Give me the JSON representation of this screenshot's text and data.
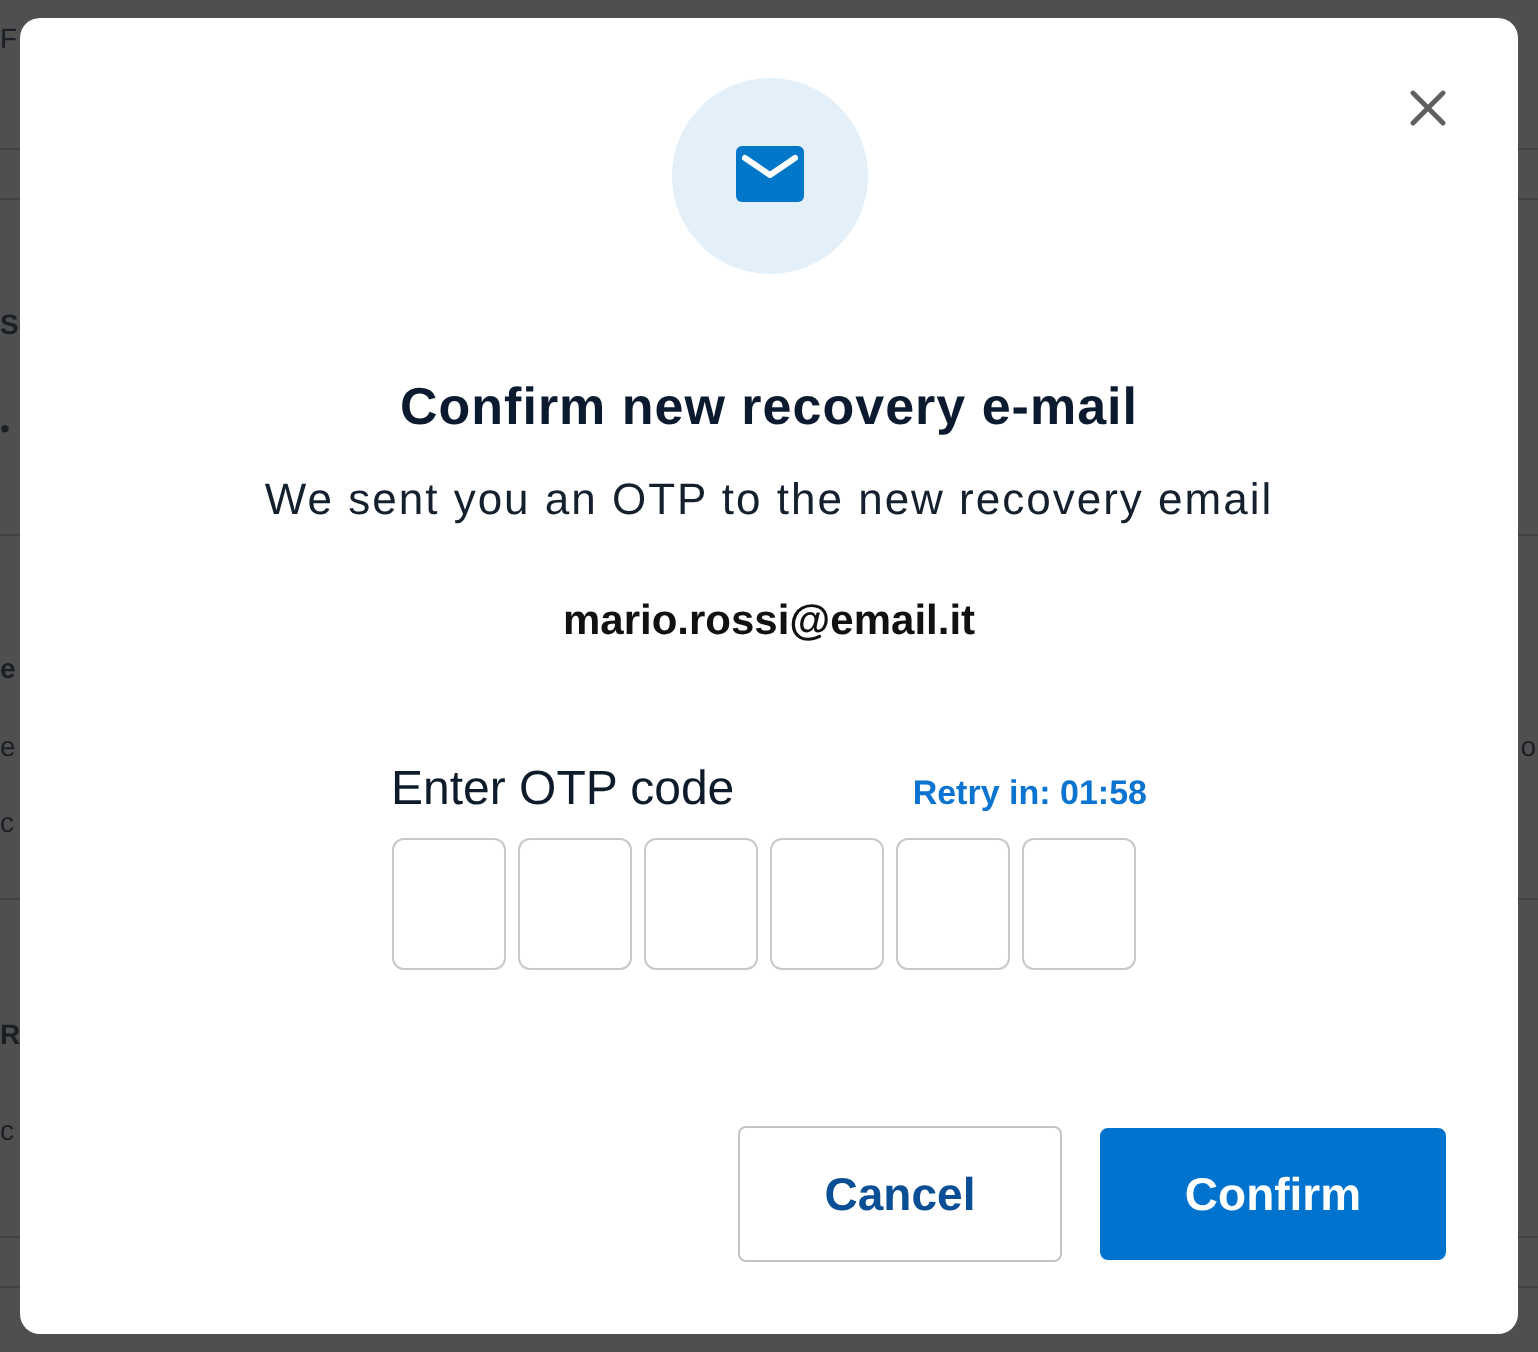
{
  "background_page": {
    "sections": [
      {
        "lines": [
          {
            "kind": "text",
            "text": "F"
          }
        ]
      },
      {
        "lines": [
          {
            "kind": "heading",
            "text": "S"
          },
          {
            "kind": "text",
            "text": "•"
          }
        ]
      },
      {
        "lines": [
          {
            "kind": "heading",
            "text": "e"
          },
          {
            "kind": "text",
            "text": "e",
            "right_text": "o"
          },
          {
            "kind": "text",
            "text": "c"
          }
        ]
      },
      {
        "lines": [
          {
            "kind": "heading",
            "text": "R"
          },
          {
            "kind": "text",
            "text": "c"
          }
        ]
      }
    ]
  },
  "dialog": {
    "title": "Confirm new recovery e-mail",
    "message": "We sent you an OTP to the new recovery email",
    "email": "mario.rossi@email.it",
    "otp": {
      "label": "Enter OTP code",
      "retry_timer": "Retry in: 01:58",
      "boxes": [
        {
          "focused": false
        },
        {
          "focused": false
        },
        {
          "focused": false
        },
        {
          "focused": false
        },
        {
          "focused": false
        },
        {
          "focused": false
        }
      ]
    },
    "buttons": [
      {
        "label": "Cancel",
        "kind": "secondary"
      },
      {
        "label": "Confirm",
        "kind": "primary"
      }
    ]
  }
}
